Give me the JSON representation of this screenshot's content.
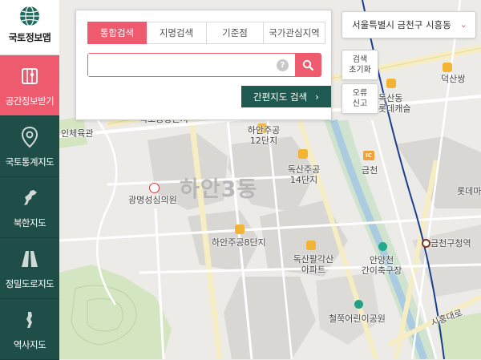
{
  "app": {
    "logo_label": "국토정보맵"
  },
  "sidebar": {
    "items": [
      {
        "label": "공간정보받기",
        "icon": "map-book-icon",
        "active": true
      },
      {
        "label": "국토통계지도",
        "icon": "location-pin-icon",
        "active": false
      },
      {
        "label": "북한지도",
        "icon": "north-korea-map-icon",
        "active": false
      },
      {
        "label": "정밀도로지도",
        "icon": "road-icon",
        "active": false
      },
      {
        "label": "역사지도",
        "icon": "history-map-icon",
        "active": false
      }
    ]
  },
  "search": {
    "tabs": [
      "통합검색",
      "지명검색",
      "기준점",
      "국가관심지역"
    ],
    "active_tab": "통합검색",
    "input_value": "",
    "help_glyph": "?",
    "easy_search_label": "간편지도 검색",
    "easy_search_chevron": "›"
  },
  "region_select": {
    "value": "서울특별시 금천구 시흥동",
    "dropdown_glyph": "⌄"
  },
  "buttons": {
    "reset_search": [
      "검색",
      "초기화"
    ],
    "error_report": [
      "오류",
      "신고"
    ]
  },
  "map": {
    "dong_label": "하안3동",
    "labels": {
      "hayan12": [
        "하안주공",
        "12단지"
      ],
      "doksan14": [
        "독산주공",
        "14단지"
      ],
      "hospital": "광명성심의원",
      "hayan8": "하안주공8단지",
      "doksan_palgak": [
        "독산팔각산",
        "아파트"
      ],
      "geumcheon": "금천",
      "anyang_stream": [
        "안양천",
        "간이축구장"
      ],
      "cheolsuk_park": "철쭉어린이공원",
      "geumcheon_gu_office": "금천구청역",
      "doksan_dong": "덕산쌍",
      "doksan_dong2": [
        "독산동",
        "롯데캐슬"
      ],
      "lotte_partial": "롯데마",
      "school_partial": "인체육관",
      "top_partial": "국도공항근지",
      "sihung_road": "시흥대로",
      "ic_badge": "IC"
    },
    "colors": {
      "base": "#ecebe8",
      "road": "#ffffff",
      "main_road": "#f7edc2",
      "river": "#aacbe0",
      "green": "#d3e5c1",
      "block": "#d8d7d4",
      "rail": "#1b3d8f"
    }
  },
  "colors": {
    "accent": "#ee5b6f",
    "sidebar_bg": "#1f4d48",
    "easy_search_bg": "#1f5a50"
  }
}
